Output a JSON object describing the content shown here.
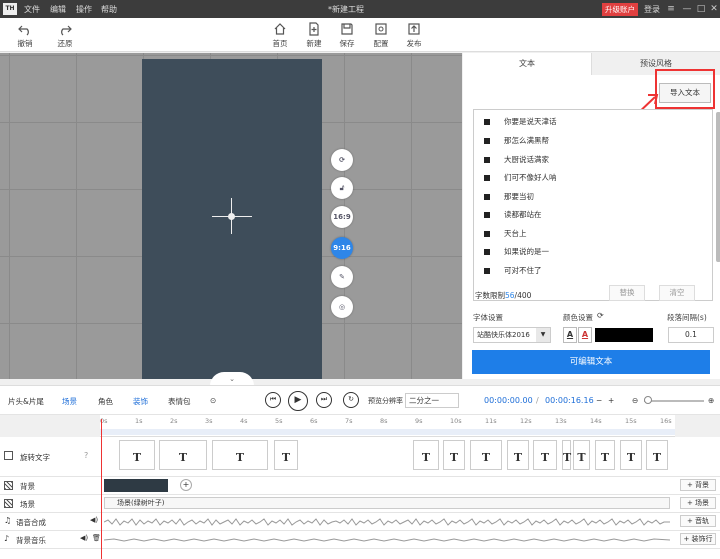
{
  "titlebar": {
    "logo": "TH",
    "menus": [
      "文件",
      "编辑",
      "操作",
      "帮助"
    ],
    "title": "*新建工程",
    "upgrade": "升级账户",
    "login": "登录",
    "win": [
      "≡",
      "—",
      "□",
      "✕"
    ]
  },
  "toolbar": {
    "undo": "撤销",
    "redo": "还原",
    "home": "首页",
    "new": "新建",
    "save": "保存",
    "settings": "配置",
    "publish": "发布"
  },
  "canvas": {
    "side_buttons": [
      "16:9",
      "9:16"
    ]
  },
  "right_panel": {
    "tabs": [
      "文本",
      "预设风格"
    ],
    "import_btn": "导入文本",
    "lines": [
      "你要是说天津话",
      "那怎么满黑帮",
      "大厨说话满家",
      "们可不像好人呐",
      "那要当初",
      "读都都站在",
      "天台上",
      "如果说的是一",
      "可对不住了"
    ],
    "limit_label": "字数限制",
    "limit_count": "56",
    "limit_total": "/400",
    "replace_btn": "替换",
    "clear_btn": "清空",
    "font_label": "字体设置",
    "color_label": "颜色设置",
    "spacing_label": "段落间隔(s)",
    "font_value": "站酷快乐体2016",
    "color_a": "A",
    "color_swatch": "#000000",
    "spacing_value": "0.1",
    "edit_btn": "可编辑文本"
  },
  "timeline_bar": {
    "items": [
      "片头&片尾",
      "场景",
      "角色",
      "装饰",
      "表情包"
    ],
    "ratio_label": "预览分辨率",
    "ratio_value": "二分之一",
    "time_current": "00:00:00.00",
    "time_sep": "/",
    "time_total": "00:00:16.16"
  },
  "ruler": [
    "0s",
    "1s",
    "2s",
    "3s",
    "4s",
    "5s",
    "6s",
    "7s",
    "8s",
    "9s",
    "10s",
    "11s",
    "12s",
    "13s",
    "14s",
    "15s",
    "16s"
  ],
  "tracks": {
    "text_track": "旋转文字",
    "bg": "背景",
    "scene": "场景",
    "voice": "语音合成",
    "music": "背景音乐",
    "scene_clip": "场景(绿树叶子)",
    "add_bg": "+ 背景",
    "add_scene": "+ 场景",
    "add_audio": "+ 音轨",
    "add_decor": "+ 装饰行",
    "seg_letter": "T"
  }
}
